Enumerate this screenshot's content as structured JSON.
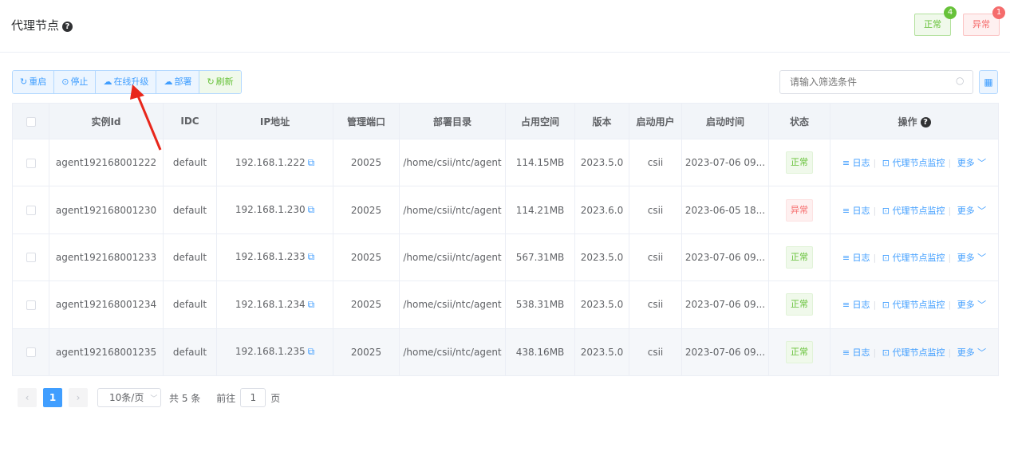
{
  "header": {
    "title": "代理节点",
    "help_icon": "?",
    "status_ok": {
      "label": "正常",
      "count": "4"
    },
    "status_err": {
      "label": "异常",
      "count": "1"
    }
  },
  "toolbar": {
    "restart": "重启",
    "stop": "停止",
    "upgrade": "在线升级",
    "deploy": "部署",
    "refresh": "刷新"
  },
  "search": {
    "placeholder": "请输入筛选条件"
  },
  "table": {
    "columns": [
      "实例Id",
      "IDC",
      "IP地址",
      "管理端口",
      "部署目录",
      "占用空间",
      "版本",
      "启动用户",
      "启动时间",
      "状态",
      "操作"
    ],
    "rows": [
      {
        "id": "agent192168001222",
        "idc": "default",
        "ip": "192.168.1.222",
        "port": "20025",
        "dir": "/home/csii/ntc/agent",
        "space": "114.15MB",
        "version": "2023.5.0",
        "user": "csii",
        "time": "2023-07-06 09...",
        "status": "正常",
        "status_type": "ok"
      },
      {
        "id": "agent192168001230",
        "idc": "default",
        "ip": "192.168.1.230",
        "port": "20025",
        "dir": "/home/csii/ntc/agent",
        "space": "114.21MB",
        "version": "2023.6.0",
        "user": "csii",
        "time": "2023-06-05 18...",
        "status": "异常",
        "status_type": "err"
      },
      {
        "id": "agent192168001233",
        "idc": "default",
        "ip": "192.168.1.233",
        "port": "20025",
        "dir": "/home/csii/ntc/agent",
        "space": "567.31MB",
        "version": "2023.5.0",
        "user": "csii",
        "time": "2023-07-06 09...",
        "status": "正常",
        "status_type": "ok"
      },
      {
        "id": "agent192168001234",
        "idc": "default",
        "ip": "192.168.1.234",
        "port": "20025",
        "dir": "/home/csii/ntc/agent",
        "space": "538.31MB",
        "version": "2023.5.0",
        "user": "csii",
        "time": "2023-07-06 09...",
        "status": "正常",
        "status_type": "ok"
      },
      {
        "id": "agent192168001235",
        "idc": "default",
        "ip": "192.168.1.235",
        "port": "20025",
        "dir": "/home/csii/ntc/agent",
        "space": "438.16MB",
        "version": "2023.5.0",
        "user": "csii",
        "time": "2023-07-06 09...",
        "status": "正常",
        "status_type": "ok"
      }
    ],
    "ops": {
      "log": "日志",
      "monitor": "代理节点监控",
      "more": "更多"
    }
  },
  "pager": {
    "current": "1",
    "page_size": "10条/页",
    "total": "共 5 条",
    "goto": "前往",
    "goto_value": "1",
    "page_unit": "页"
  },
  "colors": {
    "primary": "#409eff",
    "success": "#67c23a",
    "danger": "#f56c6c",
    "annotation_arrow": "#e8261b"
  }
}
